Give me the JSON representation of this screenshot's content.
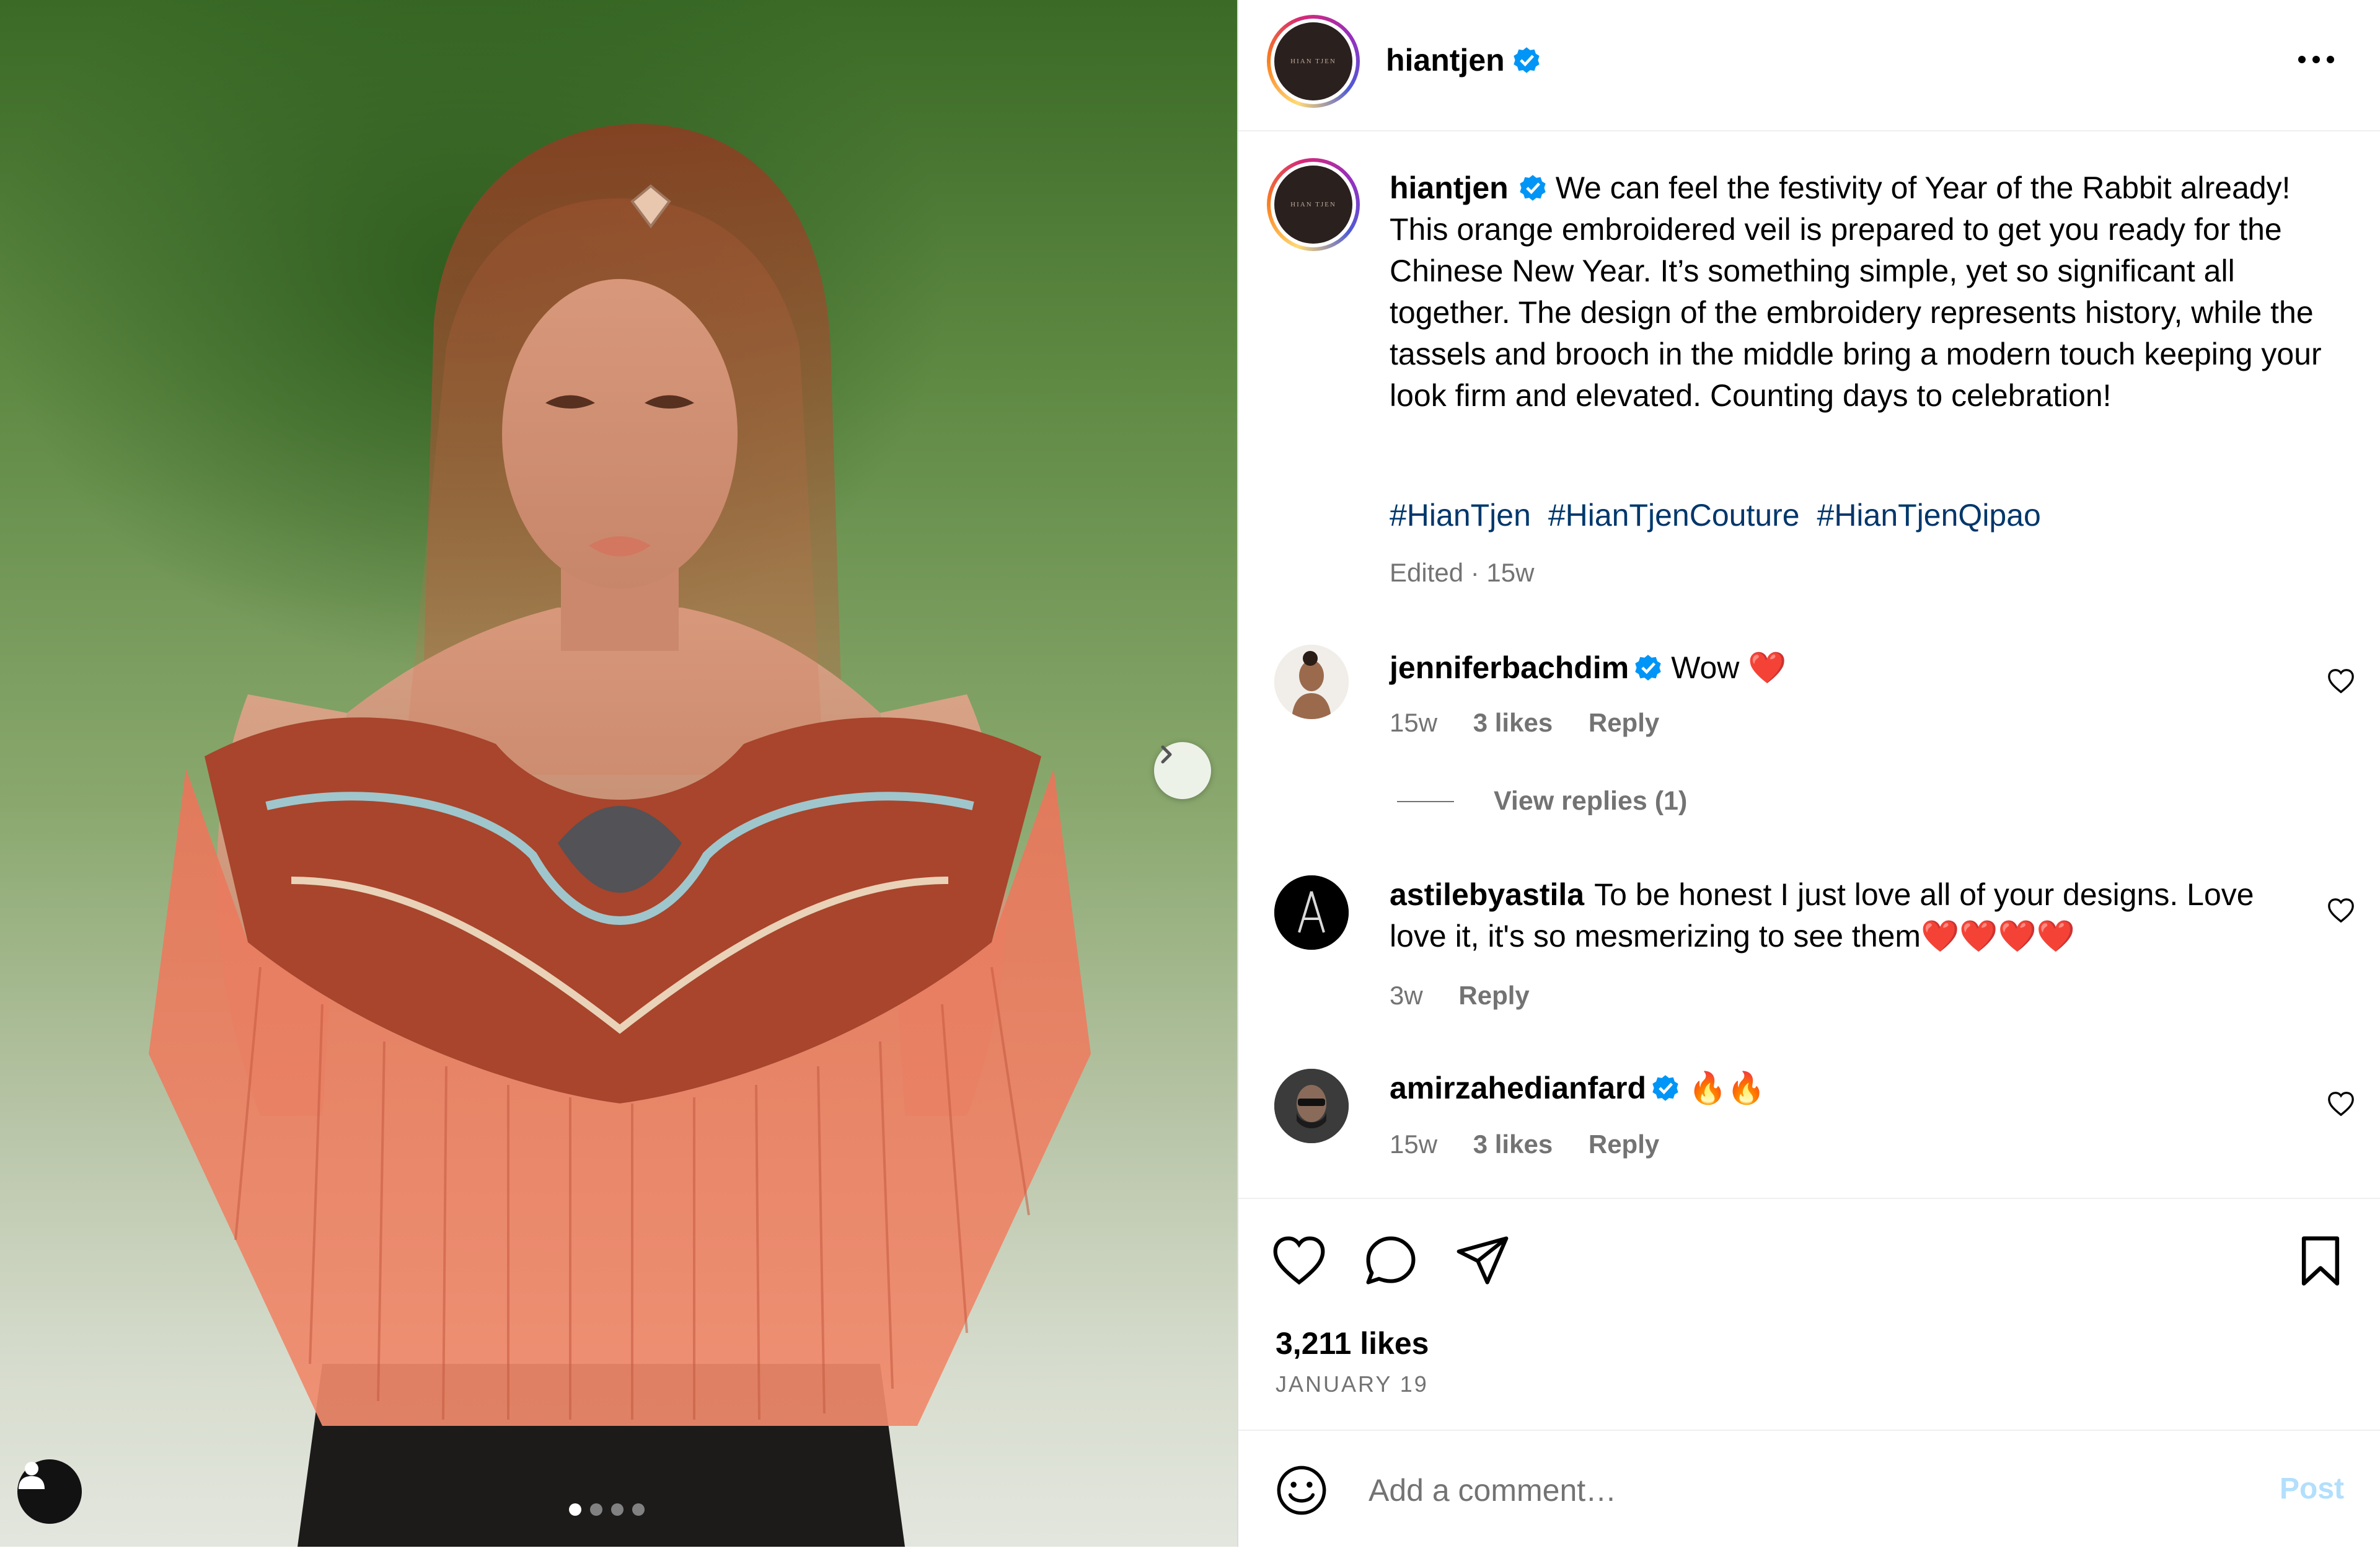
{
  "post": {
    "username": "hiantjen",
    "logo_text": "HIAN TJEN",
    "verified": true,
    "caption_text": "We can feel the festivity of Year of the Rabbit already! This orange embroidered veil is prepared to get you ready for the Chinese New Year. It’s something simple, yet so significant all together. The design of the embroidery represents history, while the tassels and brooch in the middle bring a modern touch keeping your look firm and elevated. Counting days to celebration!",
    "hashtags": [
      "#HianTjen",
      "#HianTjenCouture",
      "#HianTjenQipao"
    ],
    "edited_label": "Edited · 15w",
    "likes": "3,211 likes",
    "date": "JANUARY 19",
    "carousel_dots": 4,
    "carousel_active": 0
  },
  "comments": [
    {
      "username": "jenniferbachdim",
      "verified": true,
      "text": "Wow ❤️",
      "age": "15w",
      "likes": "3 likes",
      "reply": "Reply",
      "view_replies": "View replies (1)"
    },
    {
      "username": "astilebyastila",
      "verified": false,
      "text": "To be honest I just love all of your designs. Love love it, it's so mesmerizing to see them❤️❤️❤️❤️",
      "age": "3w",
      "likes": "",
      "reply": "Reply"
    },
    {
      "username": "amirzahedianfard",
      "verified": true,
      "text": "🔥🔥",
      "age": "15w",
      "likes": "3 likes",
      "reply": "Reply"
    }
  ],
  "add_comment": {
    "placeholder": "Add a comment…",
    "post_label": "Post"
  },
  "colors": {
    "link": "#00376b",
    "muted": "#737373",
    "verified": "#0095f6",
    "post_disabled": "#b2dffc"
  },
  "icons": [
    "chevron-right-icon",
    "user-tag-icon",
    "more-icon",
    "heart-icon",
    "comment-icon",
    "share-icon",
    "bookmark-icon",
    "emoji-icon",
    "verified-icon"
  ]
}
